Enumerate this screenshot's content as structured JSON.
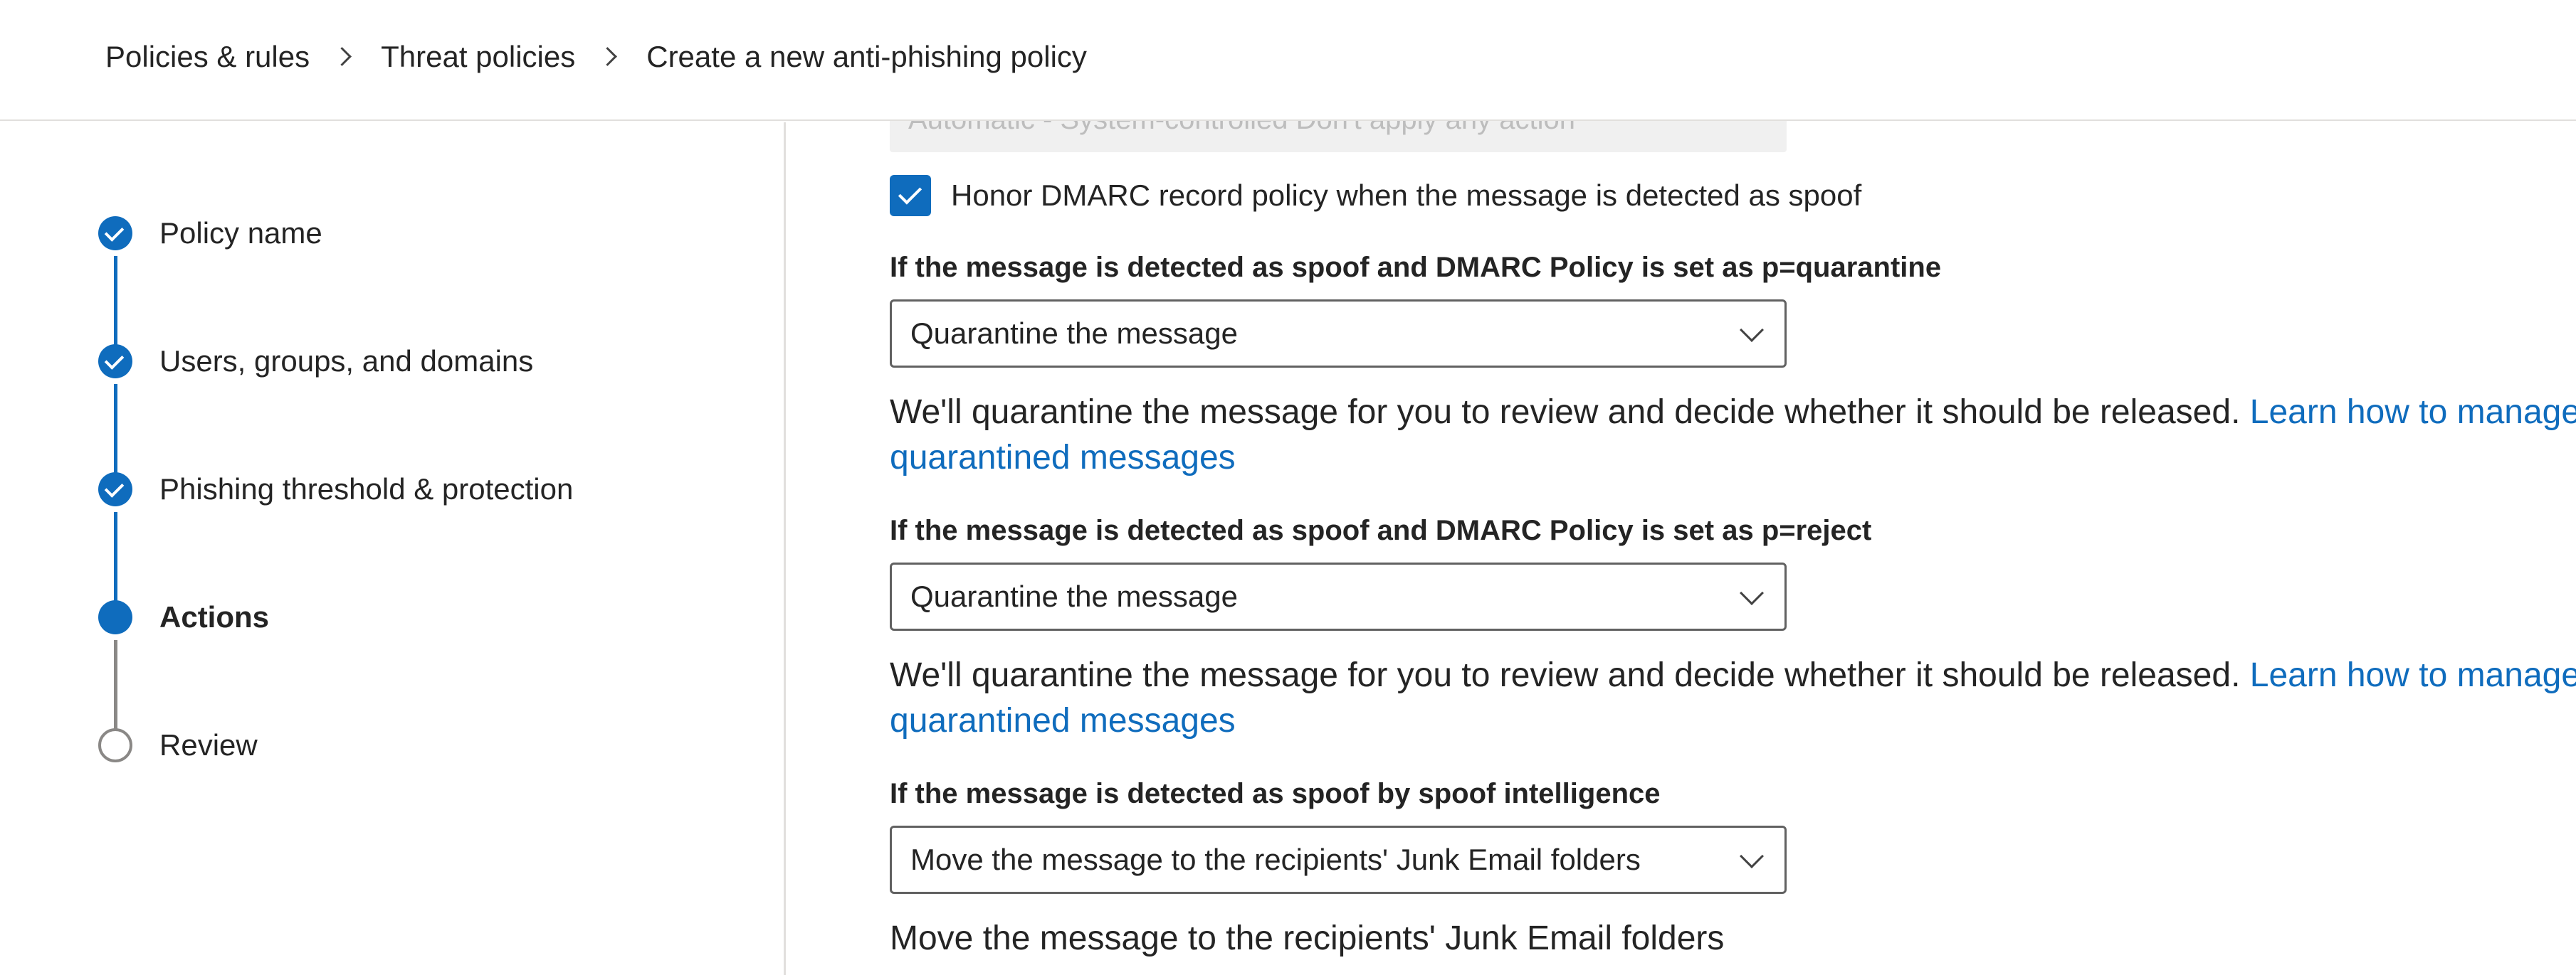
{
  "breadcrumb": {
    "items": [
      "Policies & rules",
      "Threat policies"
    ],
    "current": "Create a new anti-phishing policy"
  },
  "wizard": {
    "steps": [
      {
        "label": "Policy name",
        "state": "done"
      },
      {
        "label": "Users, groups, and domains",
        "state": "done"
      },
      {
        "label": "Phishing threshold & protection",
        "state": "done"
      },
      {
        "label": "Actions",
        "state": "current"
      },
      {
        "label": "Review",
        "state": "todo"
      }
    ]
  },
  "main": {
    "top_dropdown_value": "Automatic - System-controlled Don't apply any action",
    "honor_dmarc": {
      "label": "Honor DMARC record policy when the message is detected as spoof",
      "checked": true
    },
    "sections": [
      {
        "label": "If the message is detected as spoof and DMARC Policy is set as p=quarantine",
        "value": "Quarantine the message",
        "desc": "We'll quarantine the message for you to review and decide whether it should be released. ",
        "link": "Learn how to manage quarantined messages"
      },
      {
        "label": "If the message is detected as spoof and DMARC Policy is set as p=reject",
        "value": "Quarantine the message",
        "desc": "We'll quarantine the message for you to review and decide whether it should be released. ",
        "link": "Learn how to manage quarantined messages"
      },
      {
        "label": "If the message is detected as spoof by spoof intelligence",
        "value": "Move the message to the recipients' Junk Email folders",
        "desc": "Move the message to the recipients' Junk Email folders",
        "link": ""
      }
    ]
  },
  "colors": {
    "accent": "#0f6cbd",
    "text": "#242424",
    "border": "#616161",
    "inactive_step": "#8a8886"
  }
}
